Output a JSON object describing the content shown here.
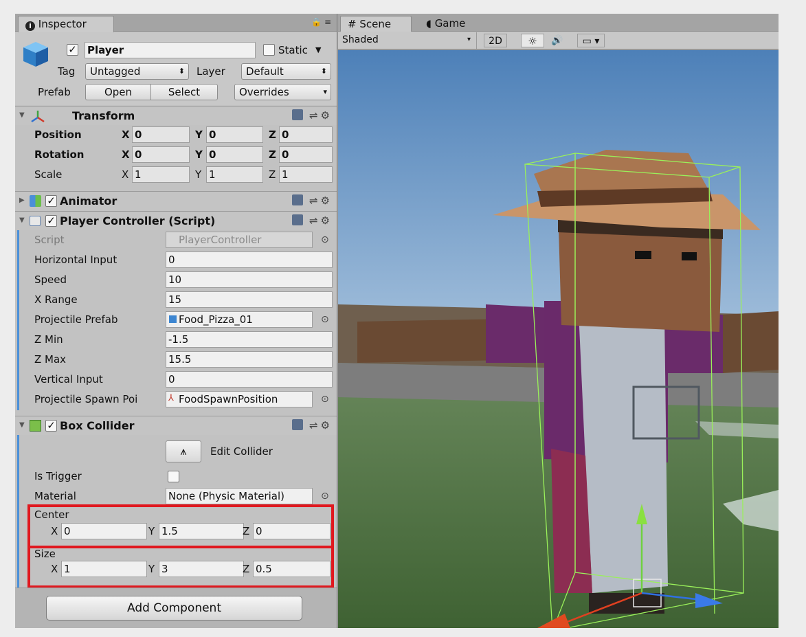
{
  "inspector": {
    "tab_label": "Inspector",
    "object_name": "Player",
    "static_label": "Static",
    "tag_label": "Tag",
    "tag_value": "Untagged",
    "layer_label": "Layer",
    "layer_value": "Default",
    "prefab_label": "Prefab",
    "prefab_open": "Open",
    "prefab_select": "Select",
    "prefab_overrides": "Overrides"
  },
  "transform": {
    "title": "Transform",
    "position_label": "Position",
    "rotation_label": "Rotation",
    "scale_label": "Scale",
    "x": "X",
    "y": "Y",
    "z": "Z",
    "position": [
      "0",
      "0",
      "0"
    ],
    "rotation": [
      "0",
      "0",
      "0"
    ],
    "scale": [
      "1",
      "1",
      "1"
    ]
  },
  "animator": {
    "title": "Animator"
  },
  "player_controller": {
    "title": "Player Controller (Script)",
    "script_label": "Script",
    "script_value": "PlayerController",
    "rows": [
      {
        "label": "Horizontal Input",
        "value": "0"
      },
      {
        "label": "Speed",
        "value": "10"
      },
      {
        "label": "X Range",
        "value": "15"
      },
      {
        "label": "Projectile Prefab",
        "value": "Food_Pizza_01"
      },
      {
        "label": "Z Min",
        "value": "-1.5"
      },
      {
        "label": "Z Max",
        "value": "15.5"
      },
      {
        "label": "Vertical Input",
        "value": "0"
      },
      {
        "label": "Projectile Spawn Poi",
        "value": "FoodSpawnPosition"
      }
    ]
  },
  "box_collider": {
    "title": "Box Collider",
    "edit_label": "Edit Collider",
    "is_trigger_label": "Is Trigger",
    "material_label": "Material",
    "material_value": "None (Physic Material)",
    "center_label": "Center",
    "center": [
      "0",
      "1.5",
      "0"
    ],
    "size_label": "Size",
    "size": [
      "1",
      "3",
      "0.5"
    ]
  },
  "add_component_label": "Add Component",
  "scene": {
    "scene_tab": "Scene",
    "game_tab": "Game",
    "shading_mode": "Shaded",
    "mode_2d": "2D"
  },
  "colors": {
    "highlight": "#e0181f",
    "collider_green": "#9af05a"
  }
}
